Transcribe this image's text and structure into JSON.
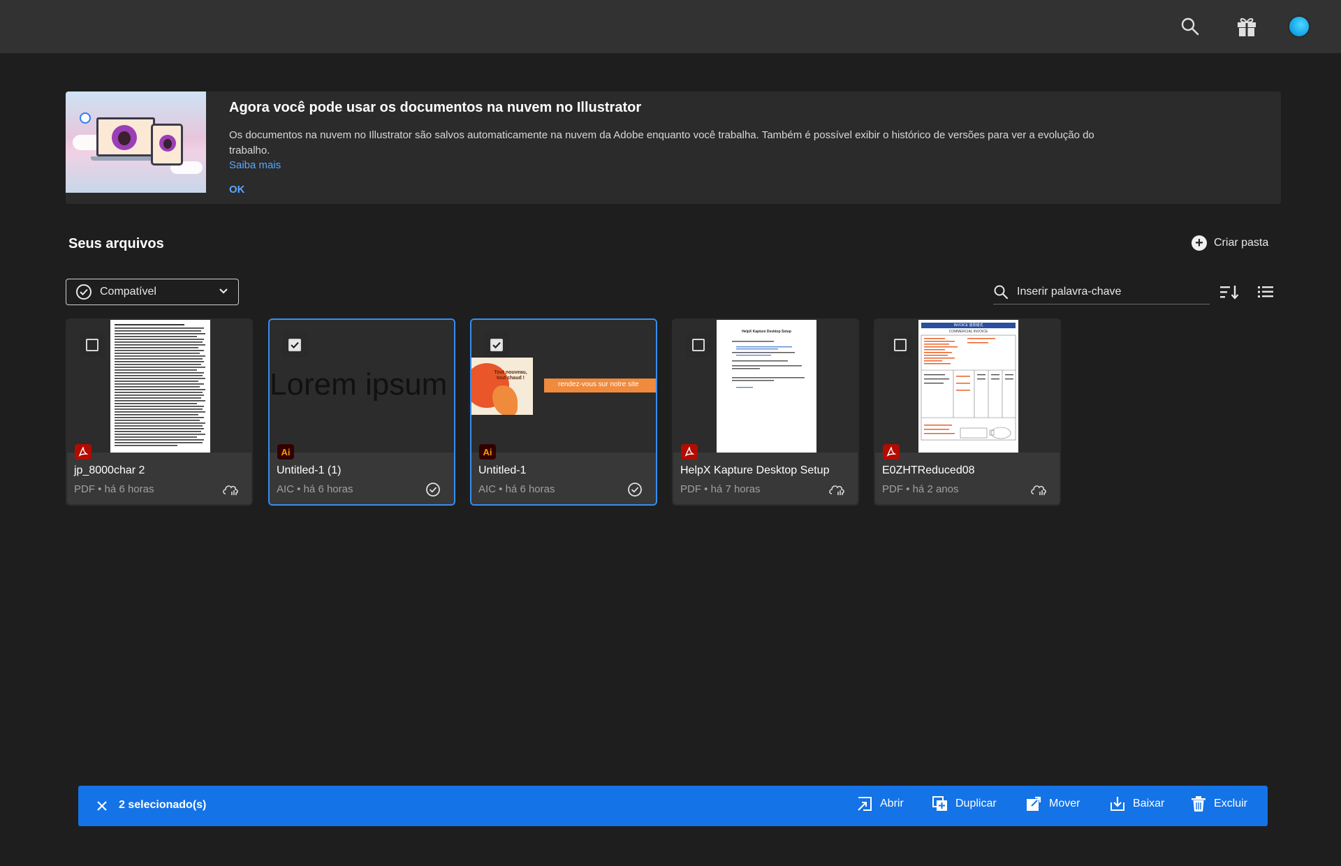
{
  "topbar": {
    "icons": [
      "search-icon",
      "gift-icon"
    ]
  },
  "banner": {
    "title": "Agora você pode usar os documentos na nuvem no Illustrator",
    "text": "Os documentos na nuvem no Illustrator são salvos automaticamente na nuvem da Adobe enquanto você trabalha. Também é possível exibir o histórico de versões para ver a evolução do trabalho.",
    "link": "Saiba mais",
    "ok": "OK"
  },
  "files_section": {
    "title": "Seus arquivos",
    "create_folder": "Criar pasta",
    "filter_label": "Compatível",
    "search_placeholder": "Inserir palavra-chave"
  },
  "files": [
    {
      "name": "jp_8000char 2",
      "meta": "PDF • há 6 horas",
      "type": "pdf",
      "type_label": "",
      "selected": false,
      "status": "cloud"
    },
    {
      "name": "Untitled-1 (1)",
      "meta": "AIC • há 6 horas",
      "type": "ai",
      "type_label": "Ai",
      "selected": true,
      "status": "synced",
      "preview_text": "Lorem ipsum"
    },
    {
      "name": "Untitled-1",
      "meta": "AIC • há 6 horas",
      "type": "ai",
      "type_label": "Ai",
      "selected": true,
      "status": "synced",
      "preview_left": "Tout nouveau, tout chaud !",
      "preview_right": "rendez-vous sur notre site"
    },
    {
      "name": "HelpX Kapture Desktop Setup",
      "meta": "PDF • há 7 horas",
      "type": "pdf",
      "type_label": "",
      "selected": false,
      "status": "cloud",
      "preview_title": "HelpX Kapture Desktop Setup"
    },
    {
      "name": "E0ZHTReduced08",
      "meta": "PDF • há 2 anos",
      "type": "pdf",
      "type_label": "",
      "selected": false,
      "status": "cloud",
      "preview_title": "INVOICE 發票樣式",
      "preview_subtitle": "COMMERCIAL INVOICE"
    }
  ],
  "actionbar": {
    "count": "2 selecionado(s)",
    "actions": [
      "Abrir",
      "Duplicar",
      "Mover",
      "Baixar",
      "Excluir"
    ]
  },
  "colors": {
    "accent": "#1473e6",
    "selected_border": "#378ef0",
    "link": "#5aa6ff",
    "pdf": "#b30b00",
    "ai_bg": "#330000",
    "ai_fg": "#ff9a00"
  }
}
